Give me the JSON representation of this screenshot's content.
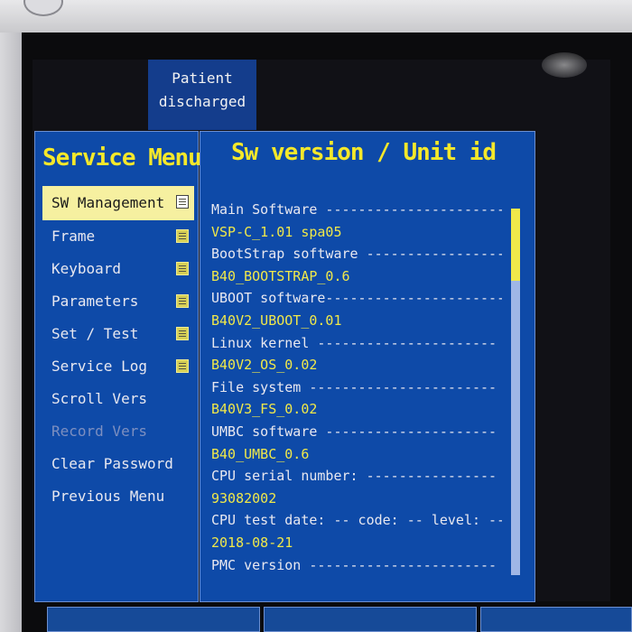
{
  "status": {
    "line1": "Patient",
    "line2": "discharged"
  },
  "menu": {
    "title": "Service Menu",
    "items": [
      {
        "label": "SW Management",
        "state": "selected",
        "icon": "document-icon"
      },
      {
        "label": "Frame",
        "state": "normal",
        "icon": "document-icon"
      },
      {
        "label": "Keyboard",
        "state": "normal",
        "icon": "document-icon"
      },
      {
        "label": "Parameters",
        "state": "normal",
        "icon": "document-icon"
      },
      {
        "label": "Set / Test",
        "state": "normal",
        "icon": "document-icon"
      },
      {
        "label": "Service Log",
        "state": "normal",
        "icon": "document-icon"
      },
      {
        "label": "Scroll Vers",
        "state": "normal"
      },
      {
        "label": "Record Vers",
        "state": "disabled"
      },
      {
        "label": "Clear Password",
        "state": "normal"
      },
      {
        "label": "Previous Menu",
        "state": "normal"
      }
    ]
  },
  "content": {
    "title": "Sw version / Unit id",
    "lines": [
      {
        "text": "Main Software -----------------------",
        "kind": "label"
      },
      {
        "text": "VSP-C_1.01 spa05",
        "kind": "value"
      },
      {
        "text": "BootStrap software -----------------",
        "kind": "label"
      },
      {
        "text": "B40_BOOTSTRAP_0.6",
        "kind": "value"
      },
      {
        "text": "UBOOT software----------------------",
        "kind": "label"
      },
      {
        "text": "B40V2_UBOOT_0.01",
        "kind": "value"
      },
      {
        "text": "Linux kernel ----------------------",
        "kind": "label"
      },
      {
        "text": "B40V2_OS_0.02",
        "kind": "value"
      },
      {
        "text": "File system -----------------------",
        "kind": "label"
      },
      {
        "text": "B40V3_FS_0.02",
        "kind": "value"
      },
      {
        "text": "UMBC software ---------------------",
        "kind": "label"
      },
      {
        "text": "B40_UMBC_0.6",
        "kind": "value"
      },
      {
        "text": "CPU serial number: ----------------",
        "kind": "label"
      },
      {
        "text": "93082002",
        "kind": "value"
      },
      {
        "text": "CPU test date: -- code: -- level: --",
        "kind": "label"
      },
      {
        "text": "2018-08-21",
        "kind": "value"
      },
      {
        "text": "PMC version -----------------------",
        "kind": "label"
      }
    ],
    "scroll_position": 0.0
  },
  "colors": {
    "panel_bg": "#0e4aa8",
    "title_yellow": "#f5e82a",
    "value_yellow": "#f0e84a",
    "selected_bg": "#f6f0a0"
  }
}
